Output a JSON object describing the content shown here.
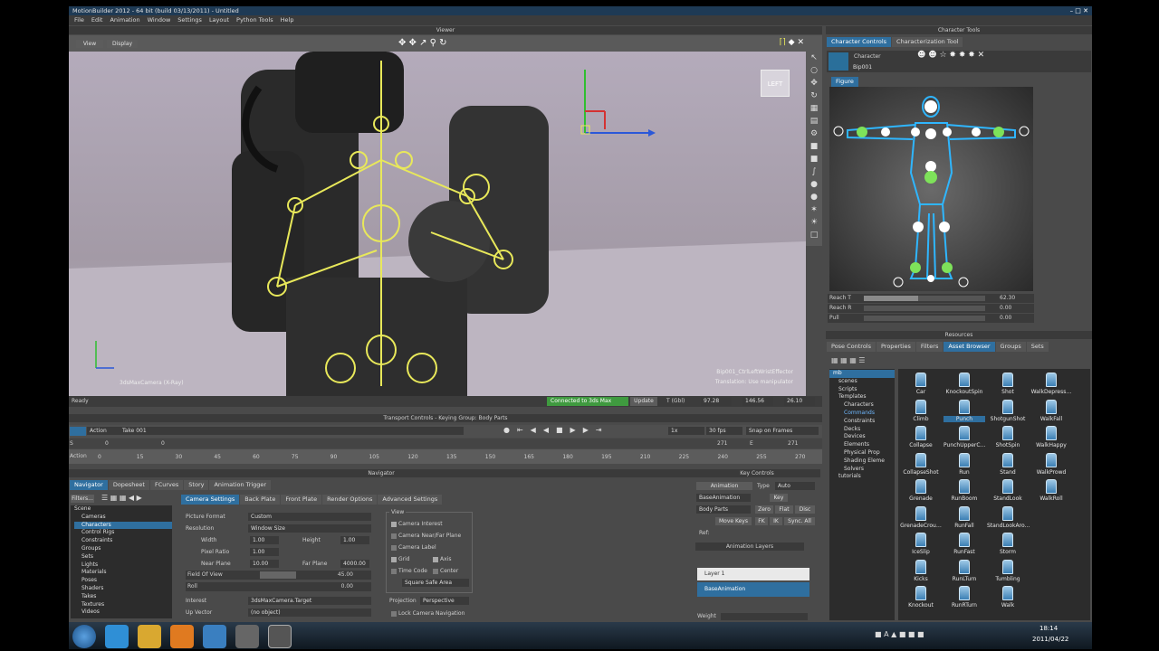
{
  "app": {
    "title": "MotionBuilder 2012 - 64 bit (build 03/13/2011) - Untitled"
  },
  "menu": [
    "File",
    "Edit",
    "Animation",
    "Window",
    "Settings",
    "Layout",
    "Python Tools",
    "Help"
  ],
  "viewer": {
    "header": "Viewer",
    "view_btn": "View",
    "display_btn": "Display",
    "left_label": "LEFT",
    "camera_label": "3dsMaxCamera (X-Ray)",
    "effector_label": "Bip001_CtrlLeftWristEffector",
    "manip_label": "Translation: Use manipulator",
    "status": "Ready",
    "connection": "Connected to 3ds Max",
    "update_btn": "Update",
    "t_label": "T (Gbl)",
    "tx": "97.28",
    "ty": "146.56",
    "tz": "26.10"
  },
  "character_tools": {
    "header": "Character Tools",
    "tabs": [
      "Character Controls",
      "Characterization Tool"
    ],
    "character_label": "Character",
    "character_name": "Bip001",
    "figure_tab": "Figure",
    "sliders": [
      {
        "label": "Reach T",
        "value": "62.30",
        "fill": 0.45
      },
      {
        "label": "Reach R",
        "value": "0.00",
        "fill": 0
      },
      {
        "label": "Pull",
        "value": "0.00",
        "fill": 0
      }
    ]
  },
  "resources": {
    "header": "Resources",
    "tabs": [
      "Pose Controls",
      "Properties",
      "Filters",
      "Asset Browser",
      "Groups",
      "Sets"
    ],
    "tree": [
      {
        "label": "mb",
        "indent": 0,
        "sel": true
      },
      {
        "label": "scenes",
        "indent": 1
      },
      {
        "label": "Scripts",
        "indent": 1
      },
      {
        "label": "Templates",
        "indent": 1
      },
      {
        "label": "Characters",
        "indent": 2
      },
      {
        "label": "Commands",
        "indent": 2,
        "hl": true
      },
      {
        "label": "Constraints",
        "indent": 2
      },
      {
        "label": "Decks",
        "indent": 2
      },
      {
        "label": "Devices",
        "indent": 2
      },
      {
        "label": "Elements",
        "indent": 2
      },
      {
        "label": "Physical Prop",
        "indent": 2
      },
      {
        "label": "Shading Eleme",
        "indent": 2
      },
      {
        "label": "Solvers",
        "indent": 2
      },
      {
        "label": "tutorials",
        "indent": 1
      }
    ],
    "assets": [
      "Car",
      "KnockoutSpin",
      "Shot",
      "WalkDepress…",
      "Climb",
      "Punch",
      "ShotgunShot",
      "WalkFall",
      "Collapse",
      "PunchUpperC…",
      "ShotSpin",
      "WalkHappy",
      "CollapseShot",
      "Run",
      "Stand",
      "WalkProwd",
      "Grenade",
      "RunBoom",
      "StandLook",
      "WalkRoll",
      "GrenadeCrou…",
      "RunFall",
      "StandLookAro…",
      "",
      "IceSlip",
      "RunFast",
      "Storm",
      "",
      "Kicks",
      "RunLTurn",
      "Tumbling",
      "",
      "Knockout",
      "RunRTurn",
      "Walk",
      ""
    ],
    "selected_asset": "Punch"
  },
  "transport": {
    "header": "Transport Controls  -  Keying Group: Body Parts",
    "action_label": "Action",
    "take": "Take 001",
    "speed": "1x",
    "fps": "30 fps",
    "snap": "Snap on Frames",
    "s_label": "S",
    "e_label": "E",
    "start": "0",
    "end": "271",
    "cur_a": "0",
    "cur_b": "271",
    "ruler_label": "Action",
    "ticks": [
      "0",
      "15",
      "30",
      "45",
      "60",
      "75",
      "90",
      "105",
      "120",
      "135",
      "150",
      "165",
      "180",
      "195",
      "210",
      "225",
      "240",
      "255",
      "270"
    ]
  },
  "navigator": {
    "header": "Navigator",
    "tabs": [
      "Navigator",
      "Dopesheet",
      "FCurves",
      "Story",
      "Animation Trigger"
    ],
    "filters": "Filters...",
    "tree": [
      "Scene",
      "Cameras",
      "Characters",
      "Control Rigs",
      "Constraints",
      "Groups",
      "Sets",
      "Lights",
      "Materials",
      "Poses",
      "Shaders",
      "Takes",
      "Textures",
      "Videos"
    ],
    "subtabs": [
      "Camera Settings",
      "Back Plate",
      "Front Plate",
      "Render Options",
      "Advanced Settings"
    ],
    "picture_format_label": "Picture Format",
    "picture_format": "Custom",
    "resolution_label": "Resolution",
    "resolution": "Window Size",
    "width_label": "Width",
    "width": "1.00",
    "height_label": "Height",
    "height": "1.00",
    "pixel_ratio_label": "Pixel Ratio",
    "pixel_ratio": "1.00",
    "near_label": "Near Plane",
    "near": "10.00",
    "far_label": "Far Plane",
    "far": "4000.00",
    "fov_label": "Field Of View",
    "fov": "45.00",
    "roll_label": "Roll",
    "roll": "0.00",
    "interest_label": "Interest",
    "interest": "3dsMaxCamera.Target",
    "up_label": "Up Vector",
    "up": "(no object)",
    "view_title": "View",
    "view_checks": [
      "Camera Interest",
      "Camera Near/Far Plane",
      "Camera Label"
    ],
    "grid": "Grid",
    "axis": "Axis",
    "timecode": "Time Code",
    "center": "Center",
    "safe_area": "Square Safe Area",
    "projection_label": "Projection",
    "projection": "Perspective",
    "lock": "Lock Camera Navigation"
  },
  "key_controls": {
    "header": "Key Controls",
    "animation_btn": "Animation",
    "type_label": "Type",
    "type": "Auto",
    "base_anim": "BaseAnimation",
    "key_btn": "Key",
    "filter": "Body Parts",
    "zero": "Zero",
    "flat": "Flat",
    "disc": "Disc",
    "move_keys": "Move Keys",
    "fk": "FK",
    "ik": "IK",
    "sync": "Sync. All",
    "ref": "Ref:",
    "layers_header": "Animation Layers",
    "layers": [
      "Layer 1",
      "BaseAnimation"
    ],
    "weight": "Weight"
  },
  "taskbar": {
    "time": "18:14",
    "date": "2011/04/22"
  },
  "colors": {
    "accent": "#2f6f9f",
    "rig": "#e8e85a",
    "viewport": "#aaa3b0",
    "connected": "#3f9a3f"
  }
}
